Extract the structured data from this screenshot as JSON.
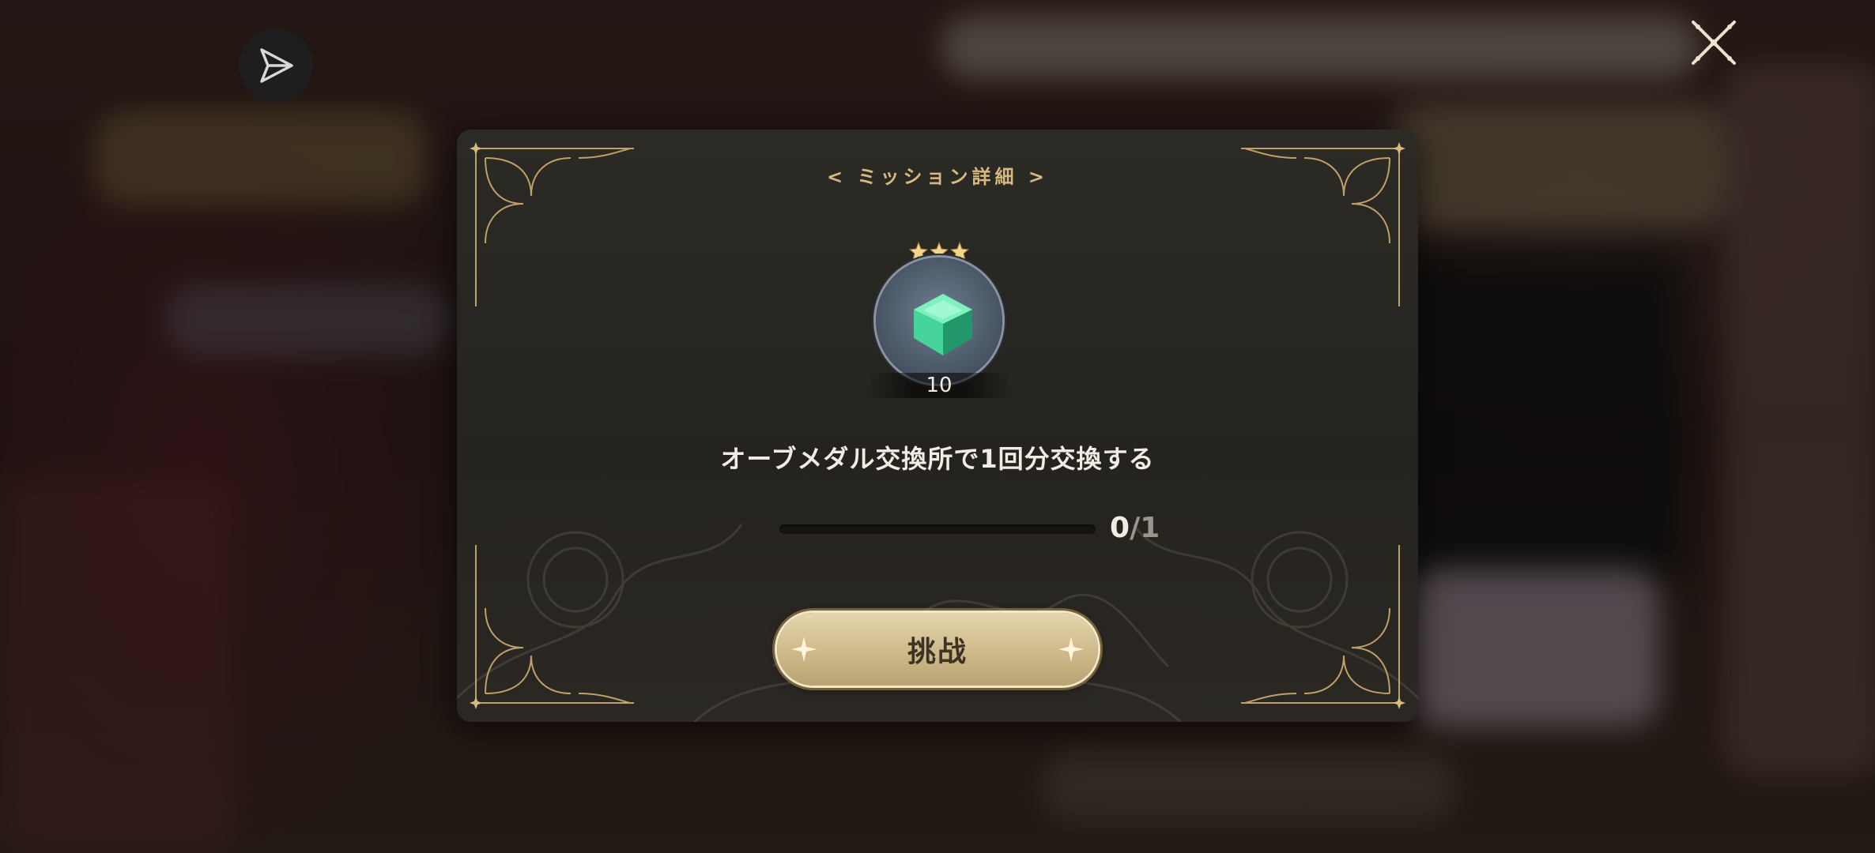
{
  "dialog": {
    "title": "< ミッション詳細 >",
    "reward": {
      "quantity": "10",
      "stars": 3,
      "icon": "green-gem-icon"
    },
    "mission_text": "オーブメダル交換所で1回分交換する",
    "progress": {
      "current": "0",
      "separator": "/",
      "total": "1",
      "fraction": 0
    },
    "challenge_label": "挑战"
  },
  "colors": {
    "accent_gold": "#d7b980",
    "button_fill": "#cdb989",
    "panel": "#28251f",
    "gem": "#46d49a"
  }
}
